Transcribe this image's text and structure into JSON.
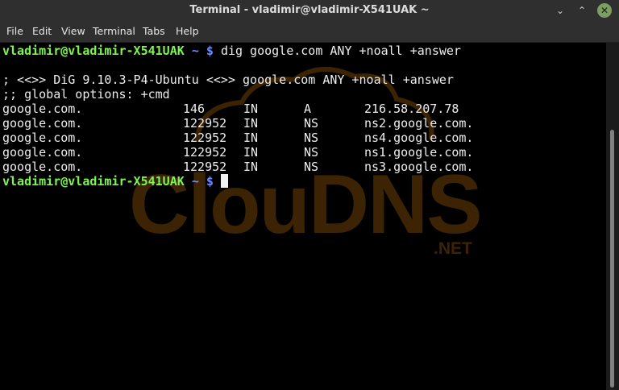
{
  "window": {
    "title": "Terminal - vladimir@vladimir-X541UAK ~"
  },
  "menu": [
    "File",
    "Edit",
    "View",
    "Terminal",
    "Tabs",
    "Help"
  ],
  "terminal": {
    "prompt_user_host": "vladimir@vladimir-X541UAK",
    "prompt_path_symbol": "~ $",
    "command": "dig google.com ANY +noall +answer",
    "dig_header": "; <<>> DiG 9.10.3-P4-Ubuntu <<>> google.com ANY +noall +answer",
    "global_options": ";; global options: +cmd",
    "records": [
      {
        "name": "google.com.",
        "ttl": "146",
        "class": "IN",
        "type": "A",
        "data": "216.58.207.78"
      },
      {
        "name": "google.com.",
        "ttl": "122952",
        "class": "IN",
        "type": "NS",
        "data": "ns2.google.com."
      },
      {
        "name": "google.com.",
        "ttl": "122952",
        "class": "IN",
        "type": "NS",
        "data": "ns4.google.com."
      },
      {
        "name": "google.com.",
        "ttl": "122952",
        "class": "IN",
        "type": "NS",
        "data": "ns1.google.com."
      },
      {
        "name": "google.com.",
        "ttl": "122952",
        "class": "IN",
        "type": "NS",
        "data": "ns3.google.com."
      }
    ]
  },
  "watermark": {
    "text": "ClouDNS",
    "suffix": ".NET"
  },
  "colors": {
    "prompt": "#7cf54e",
    "prompt_symbol": "#6f8cff",
    "text": "#ededed",
    "watermark": "#3c2303"
  }
}
